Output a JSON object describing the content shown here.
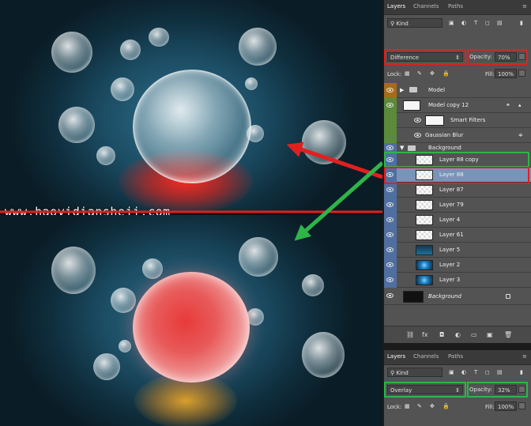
{
  "watermark": "www.haoyidiansheji.com",
  "top_panel": {
    "tabs": [
      "Layers",
      "Channels",
      "Paths"
    ],
    "filter_kind": "Kind",
    "blend_mode": "Difference",
    "opacity_label": "Opacity:",
    "opacity_value": "70%",
    "lock_label": "Lock:",
    "fill_label": "Fill:",
    "fill_value": "100%",
    "layers": [
      {
        "name": "Model",
        "type": "group",
        "color": "#a86b1a"
      },
      {
        "name": "Model copy 12",
        "type": "smart",
        "color": "#5a8a3a"
      },
      {
        "name": "Smart Filters",
        "type": "filters",
        "color": "#5a8a3a"
      },
      {
        "name": "Gaussian Blur",
        "type": "filter",
        "color": "#5a8a3a"
      },
      {
        "name": "Background",
        "type": "group-open",
        "color": "#4f6fa0"
      },
      {
        "name": "Layer 88 copy",
        "type": "layer",
        "thumb": "checker",
        "color": "#4f6fa0"
      },
      {
        "name": "Layer 88",
        "type": "layer",
        "thumb": "checker",
        "color": "#4f6fa0",
        "selected": true
      },
      {
        "name": "Layer 87",
        "type": "layer",
        "thumb": "checker",
        "color": "#4f6fa0"
      },
      {
        "name": "Layer 79",
        "type": "layer",
        "thumb": "checker",
        "color": "#4f6fa0"
      },
      {
        "name": "Layer 4",
        "type": "layer",
        "thumb": "checker",
        "color": "#4f6fa0"
      },
      {
        "name": "Layer 61",
        "type": "layer",
        "thumb": "checker",
        "color": "#4f6fa0"
      },
      {
        "name": "Layer 5",
        "type": "layer",
        "thumb": "dark",
        "color": "#4f6fa0"
      },
      {
        "name": "Layer 2",
        "type": "layer",
        "thumb": "glow",
        "color": "#4f6fa0"
      },
      {
        "name": "Layer 3",
        "type": "layer",
        "thumb": "glow",
        "color": "#4f6fa0"
      },
      {
        "name": "Background",
        "type": "background",
        "thumb": "black",
        "color": null
      }
    ],
    "bottom_icons": [
      "link-icon",
      "fx-icon",
      "mask-icon",
      "adjustment-icon",
      "folder-icon",
      "new-layer-icon",
      "trash-icon"
    ],
    "bottom_glyphs": [
      "⛓",
      "fx",
      "◘",
      "◐",
      "▭",
      "▣",
      "🗑"
    ]
  },
  "bottom_panel": {
    "tabs": [
      "Layers",
      "Channels",
      "Paths"
    ],
    "filter_kind": "Kind",
    "blend_mode": "Overlay",
    "opacity_label": "Opacity:",
    "opacity_value": "32%",
    "lock_label": "Lock:",
    "fill_label": "Fill:",
    "fill_value": "100%"
  },
  "colors": {
    "annotation_red": "#e02020",
    "annotation_green": "#2fb44a",
    "panel_bg": "#535353",
    "selected_row": "#7b93b8"
  }
}
